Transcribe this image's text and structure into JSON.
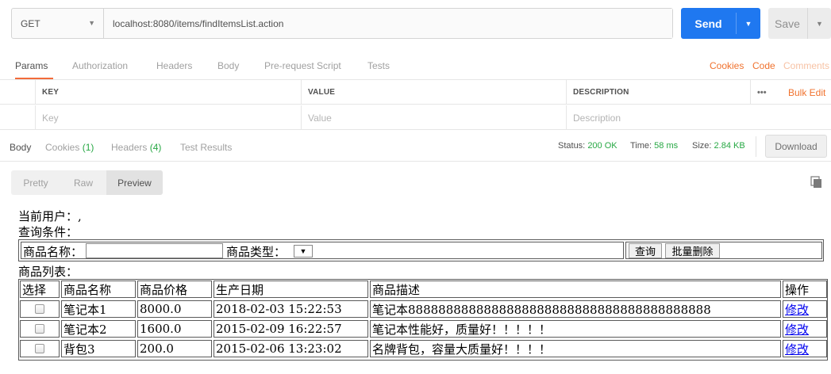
{
  "request": {
    "method": "GET",
    "url": "localhost:8080/items/findItemsList.action",
    "send_label": "Send",
    "save_label": "Save"
  },
  "request_tabs": {
    "params": "Params",
    "authorization": "Authorization",
    "headers": "Headers",
    "body": "Body",
    "prerequest": "Pre-request Script",
    "tests": "Tests",
    "cookies": "Cookies",
    "code": "Code",
    "comments": "Comments"
  },
  "params_table": {
    "key_header": "KEY",
    "value_header": "VALUE",
    "description_header": "DESCRIPTION",
    "more": "•••",
    "bulk_edit": "Bulk Edit",
    "key_placeholder": "Key",
    "value_placeholder": "Value",
    "description_placeholder": "Description"
  },
  "response_tabs": {
    "body": "Body",
    "cookies": "Cookies",
    "cookies_count": "(1)",
    "headers": "Headers",
    "headers_count": "(4)",
    "test_results": "Test Results"
  },
  "response_meta": {
    "status_label": "Status:",
    "status_value": "200 OK",
    "time_label": "Time:",
    "time_value": "58 ms",
    "size_label": "Size:",
    "size_value": "2.84 KB",
    "download_label": "Download"
  },
  "view_modes": {
    "pretty": "Pretty",
    "raw": "Raw",
    "preview": "Preview"
  },
  "preview": {
    "current_user": "当前用户：,",
    "query_conditions": "查询条件：",
    "name_label": "商品名称：",
    "type_label": "商品类型：",
    "type_select_value": "",
    "query_button": "查询",
    "batch_delete_button": "批量删除",
    "list_title": "商品列表：",
    "columns": [
      "选择",
      "商品名称",
      "商品价格",
      "生产日期",
      "商品描述",
      "操作"
    ],
    "rows": [
      {
        "name": "笔记本1",
        "price": "8000.0",
        "date": "2018-02-03 15:22:53",
        "desc": "笔记本8888888888888888888888888888888888888888",
        "action": "修改"
      },
      {
        "name": "笔记本2",
        "price": "1600.0",
        "date": "2015-02-09 16:22:57",
        "desc": "笔记本性能好，质量好！！！！！",
        "action": "修改"
      },
      {
        "name": "背包3",
        "price": "200.0",
        "date": "2015-02-06 13:23:02",
        "desc": "名牌背包，容量大质量好！！！！",
        "action": "修改"
      }
    ]
  },
  "colors": {
    "send_blue": "#1f78f0",
    "accent_orange": "#f0722e",
    "status_green": "#27a844"
  }
}
